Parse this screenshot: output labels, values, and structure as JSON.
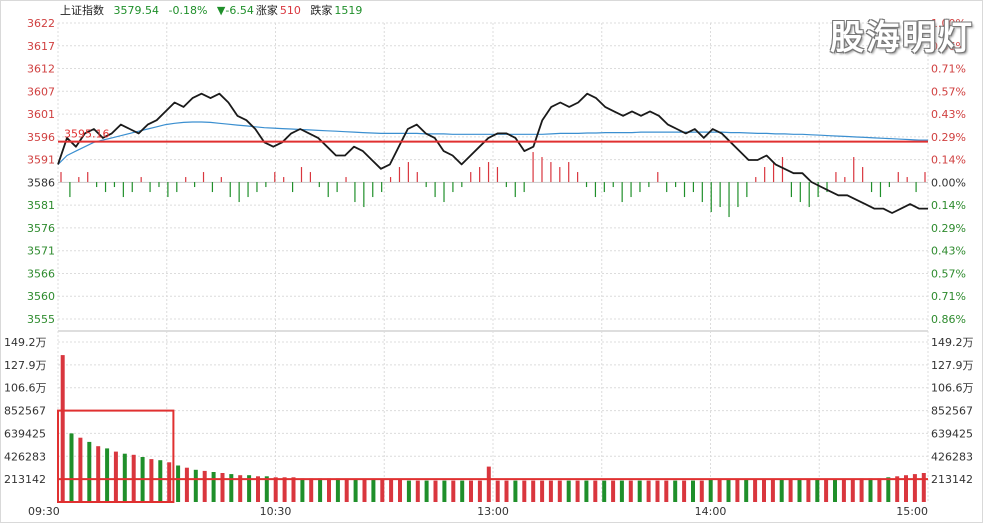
{
  "header": {
    "name": "上证指数",
    "price": "3579.54",
    "change_pct": "-0.18%",
    "change": "▼-6.54",
    "up_label": "涨家",
    "up_count": "510",
    "down_label": "跌家",
    "down_count": "1519"
  },
  "watermark": "股海明灯",
  "colors": {
    "up": "#d9363e",
    "down": "#1f8f2a",
    "axis_red": "#d04040",
    "axis_green": "#2e8b2e",
    "price_line": "#1a1a1a",
    "avg_line": "#3b8fd0",
    "annotation": "#e03030",
    "grid": "#dcdcdc"
  },
  "chart_data": [
    {
      "type": "line",
      "title": "",
      "x_ticks": [
        "09:30",
        "10:30",
        "13:00",
        "14:00",
        "15:00"
      ],
      "y_ticks_left": [
        3622,
        3617,
        3612,
        3607,
        3601,
        3596,
        3591,
        3586,
        3581,
        3576,
        3571,
        3566,
        3560,
        3555
      ],
      "y_ticks_right": [
        "1.00%",
        "0.86%",
        "0.71%",
        "0.57%",
        "0.43%",
        "0.29%",
        "0.14%",
        "0.00%",
        "0.14%",
        "0.29%",
        "0.43%",
        "0.57%",
        "0.71%",
        "0.86%"
      ],
      "ylim": [
        3555,
        3622
      ],
      "prev_close": 3586,
      "reference_line": {
        "value": 3595.16,
        "label": "3595.16"
      },
      "series": [
        {
          "values": [
            3590,
            3596,
            3594,
            3597,
            3598,
            3596,
            3597,
            3599,
            3598,
            3597,
            3599,
            3600,
            3602,
            3604,
            3603,
            3605,
            3606,
            3605,
            3606,
            3604,
            3601,
            3600,
            3598,
            3595,
            3594,
            3595,
            3597,
            3598,
            3597,
            3596,
            3594,
            3592,
            3592,
            3594,
            3593,
            3591,
            3589,
            3590,
            3594,
            3598,
            3599,
            3597,
            3596,
            3593,
            3592,
            3590,
            3592,
            3594,
            3596,
            3597,
            3597,
            3596,
            3593,
            3594,
            3600,
            3603,
            3604,
            3603,
            3604,
            3606,
            3605,
            3603,
            3602,
            3601,
            3602,
            3601,
            3602,
            3601,
            3599,
            3598,
            3597,
            3598,
            3596,
            3598,
            3597,
            3595,
            3593,
            3591,
            3591,
            3592,
            3590,
            3589,
            3588,
            3588,
            3586,
            3585,
            3584,
            3583,
            3583,
            3582,
            3581,
            3580,
            3580,
            3579,
            3580,
            3581,
            3580,
            3580
          ]
        },
        {
          "values": [
            3590,
            3592,
            3593,
            3594,
            3595,
            3595.5,
            3596,
            3596.5,
            3597,
            3597.5,
            3598,
            3598.5,
            3599,
            3599.3,
            3599.5,
            3599.6,
            3599.6,
            3599.5,
            3599.3,
            3599.1,
            3598.9,
            3598.7,
            3598.5,
            3598.3,
            3598.2,
            3598.1,
            3598,
            3597.9,
            3597.8,
            3597.7,
            3597.6,
            3597.5,
            3597.4,
            3597.3,
            3597.2,
            3597.1,
            3597,
            3597,
            3597,
            3597,
            3597,
            3596.9,
            3596.9,
            3596.9,
            3596.8,
            3596.8,
            3596.8,
            3596.8,
            3596.8,
            3596.8,
            3596.8,
            3596.8,
            3596.8,
            3596.8,
            3596.8,
            3596.9,
            3597,
            3597,
            3597,
            3597.1,
            3597.1,
            3597.2,
            3597.2,
            3597.2,
            3597.2,
            3597.3,
            3597.3,
            3597.3,
            3597.3,
            3597.3,
            3597.3,
            3597.3,
            3597.3,
            3597.3,
            3597.3,
            3597.2,
            3597.2,
            3597.1,
            3597,
            3597,
            3596.9,
            3596.9,
            3596.8,
            3596.8,
            3596.7,
            3596.6,
            3596.5,
            3596.4,
            3596.3,
            3596.2,
            3596.1,
            3596,
            3595.9,
            3595.8,
            3595.7,
            3595.6,
            3595.5,
            3595.5
          ]
        }
      ],
      "breadth_bars": [
        2,
        -3,
        1,
        2,
        -1,
        -2,
        -1,
        -3,
        -2,
        1,
        -2,
        -1,
        -3,
        -2,
        1,
        -1,
        2,
        -2,
        1,
        -3,
        -4,
        -3,
        -2,
        -1,
        2,
        1,
        -2,
        3,
        2,
        -1,
        -3,
        -2,
        1,
        -4,
        -5,
        -3,
        -2,
        1,
        3,
        4,
        2,
        -1,
        -3,
        -4,
        -2,
        -1,
        2,
        3,
        4,
        3,
        -1,
        -3,
        -2,
        6,
        5,
        4,
        3,
        4,
        2,
        -1,
        -3,
        -2,
        -1,
        -4,
        -3,
        -2,
        -1,
        2,
        -2,
        -1,
        -3,
        -2,
        -4,
        -6,
        -5,
        -7,
        -5,
        -3,
        1,
        3,
        4,
        5,
        -3,
        -4,
        -5,
        -3,
        -2,
        2,
        1,
        5,
        3,
        -2,
        -3,
        -1,
        2,
        1,
        -2,
        2
      ]
    },
    {
      "type": "bar",
      "title": "",
      "y_ticks_left": [
        "149.2万",
        "127.9万",
        "106.6万",
        "852567",
        "639425",
        "426283",
        "213142"
      ],
      "y_ticks_right": [
        "149.2万",
        "127.9万",
        "106.6万",
        "852567",
        "639425",
        "426283",
        "213142"
      ],
      "ylim": [
        0,
        1492000
      ],
      "reference_line": {
        "value": 213142
      },
      "highlight_range": {
        "from_index": 0,
        "to_index": 12
      },
      "values": [
        1370000,
        640000,
        600000,
        560000,
        520000,
        500000,
        470000,
        450000,
        440000,
        420000,
        400000,
        390000,
        370000,
        340000,
        320000,
        300000,
        290000,
        280000,
        270000,
        260000,
        250000,
        250000,
        240000,
        240000,
        230000,
        230000,
        230000,
        220000,
        220000,
        220000,
        220000,
        220000,
        210000,
        210000,
        210000,
        210000,
        210000,
        210000,
        210000,
        200000,
        200000,
        200000,
        200000,
        200000,
        200000,
        200000,
        200000,
        200000,
        330000,
        200000,
        200000,
        200000,
        200000,
        200000,
        200000,
        200000,
        200000,
        200000,
        200000,
        200000,
        200000,
        200000,
        200000,
        200000,
        200000,
        200000,
        200000,
        200000,
        200000,
        200000,
        200000,
        200000,
        200000,
        210000,
        210000,
        210000,
        210000,
        210000,
        210000,
        210000,
        210000,
        210000,
        210000,
        210000,
        210000,
        210000,
        210000,
        210000,
        210000,
        210000,
        220000,
        220000,
        220000,
        230000,
        240000,
        250000,
        260000,
        270000
      ]
    }
  ]
}
